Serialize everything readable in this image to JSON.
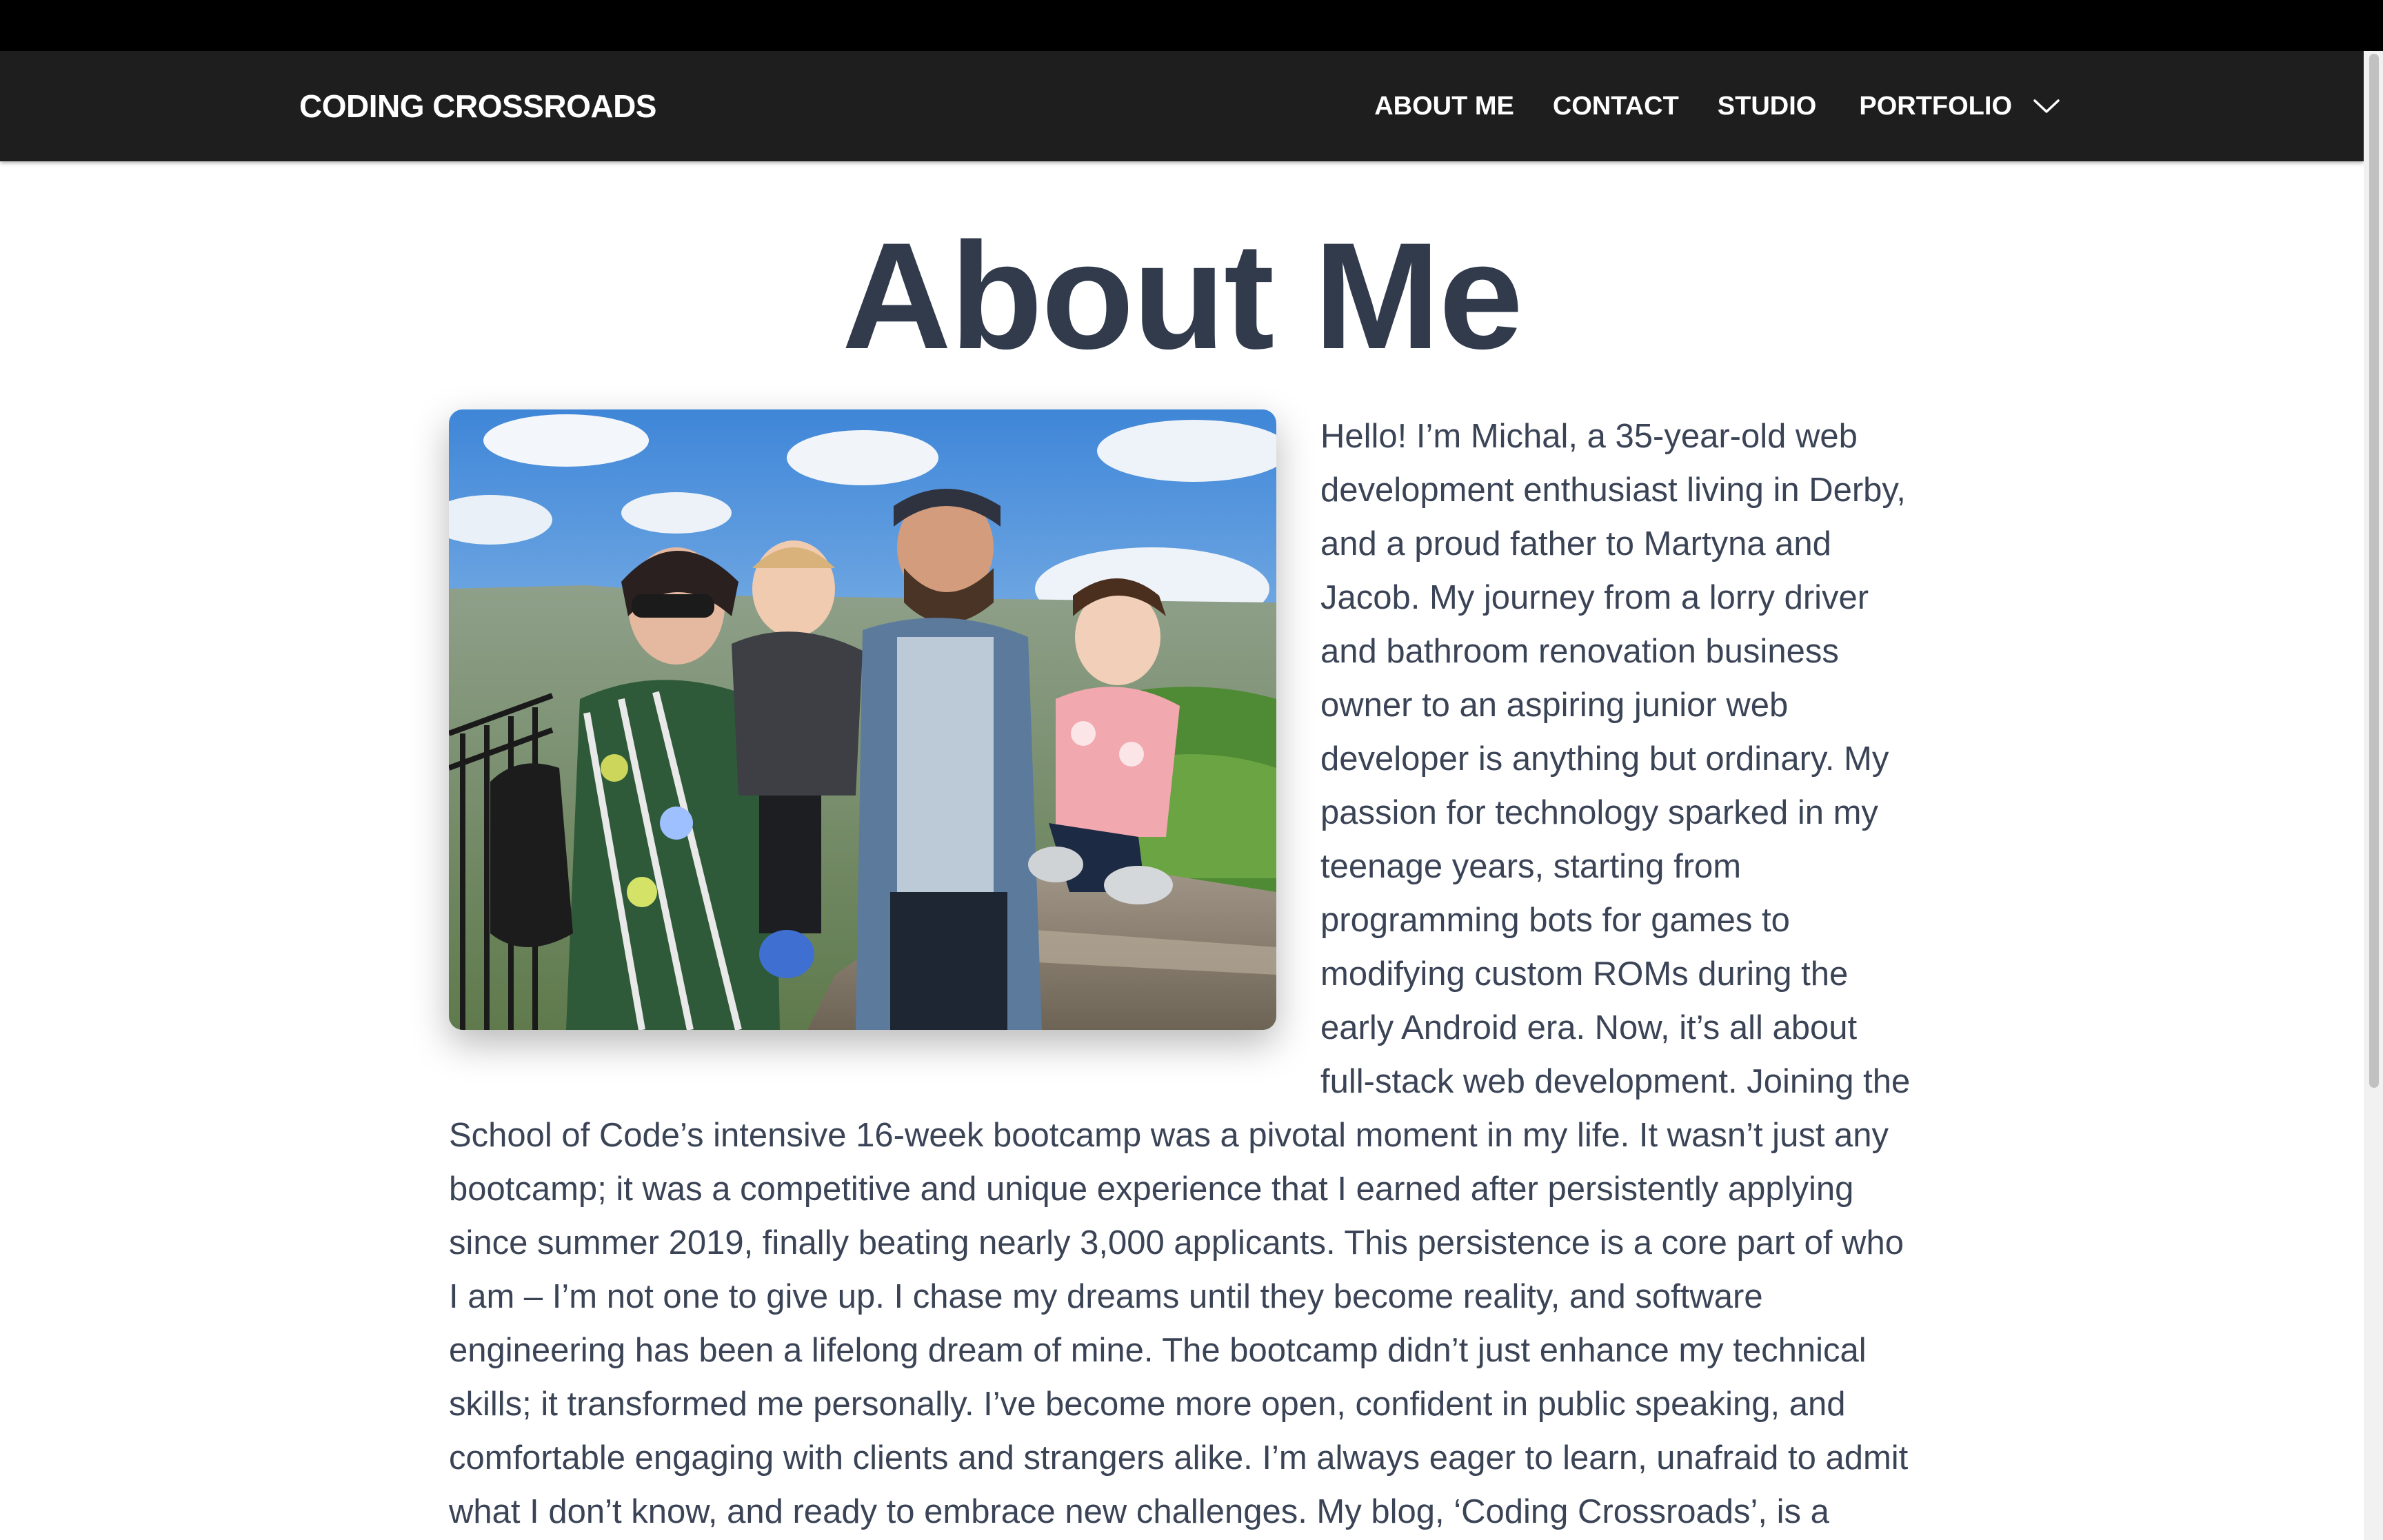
{
  "brand": {
    "name": "CODING CROSSROADS"
  },
  "nav": {
    "items": [
      {
        "label": "ABOUT ME"
      },
      {
        "label": "CONTACT"
      },
      {
        "label": "STUDIO"
      },
      {
        "label": "PORTFOLIO"
      }
    ],
    "portfolio_dropdown_icon": "chevron-down-icon"
  },
  "main": {
    "title": "About Me",
    "photo_alt": "Family photo",
    "bio": "Hello! I’m Michal, a 35-year-old web development enthusiast living in Derby, and a proud father to Martyna and Jacob. My journey from a lorry driver and bathroom renovation business owner to an aspiring junior web developer is anything but ordinary. My passion for technology sparked in my teenage years, starting from programming bots for games to modifying custom ROMs during the early Android era. Now, it’s all about full-stack web development. Joining the School of Code’s intensive 16-week bootcamp was a pivotal moment in my life. It wasn’t just any bootcamp; it was a competitive and unique experience that I earned after persistently applying since summer 2019, finally beating nearly 3,000 applicants. This persistence is a core part of who I am – I’m not one to give up. I chase my dreams until they become reality, and software engineering has been a lifelong dream of mine. The bootcamp didn’t just enhance my technical skills; it transformed me personally. I’ve become more open, confident in public speaking, and comfortable engaging with clients and strangers alike. I’m always eager to learn, unafraid to admit what I don’t know, and ready to embrace new challenges. My blog, ‘Coding Crossroads’, is a testament to this journey. It’s"
  },
  "colors": {
    "navbar_bg": "#1e1e1e",
    "title": "#323b4c",
    "body_text": "#3b4456",
    "top_bar": "#000000"
  }
}
